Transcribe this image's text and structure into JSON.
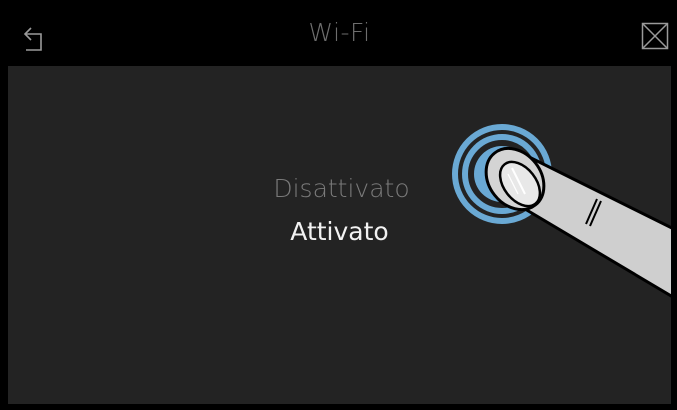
{
  "header": {
    "title": "Wi-Fi",
    "back_icon": "back-arrow-icon",
    "close_icon": "close-x-icon"
  },
  "picker": {
    "options": [
      "Disattivato",
      "Attivato"
    ],
    "selected": "Attivato"
  },
  "gesture": {
    "icon": "finger-tap-icon"
  },
  "colors": {
    "background": "#232323",
    "header": "#000000",
    "accent_ring": "#6aa9d4"
  }
}
